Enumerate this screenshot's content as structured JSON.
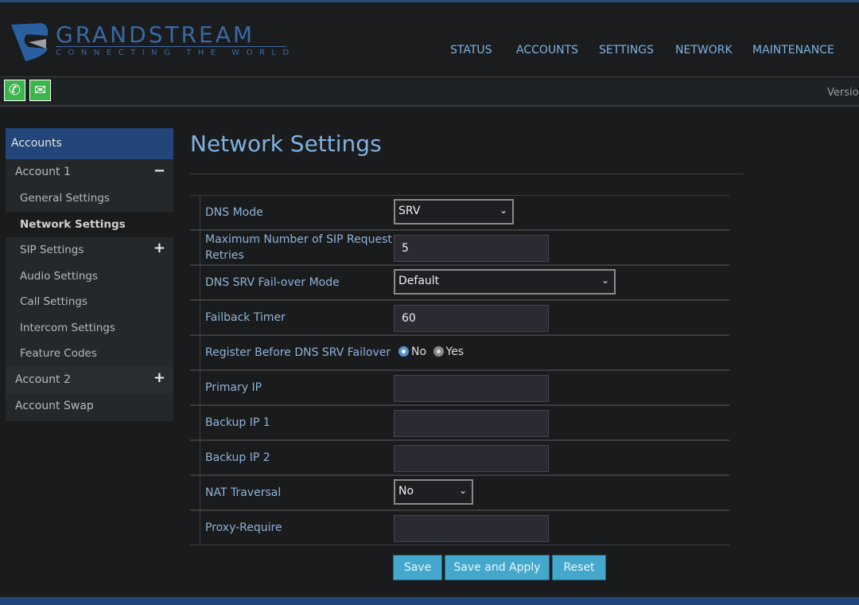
{
  "header": {
    "brand": "GRANDSTREAM",
    "tagline": "CONNECTING THE WORLD",
    "nav": [
      "STATUS",
      "ACCOUNTS",
      "SETTINGS",
      "NETWORK",
      "MAINTENANCE"
    ],
    "version_label": "Version"
  },
  "toolbar": {
    "icons": [
      "phone-icon",
      "contact-card-icon"
    ]
  },
  "sidebar": {
    "heading": "Accounts",
    "account1": "Account 1",
    "items": [
      "General Settings",
      "Network Settings",
      "SIP Settings",
      "Audio Settings",
      "Call Settings",
      "Intercom Settings",
      "Feature Codes"
    ],
    "account2": "Account 2",
    "swap": "Account Swap"
  },
  "page": {
    "title": "Network Settings"
  },
  "form": {
    "dns_mode": {
      "label": "DNS Mode",
      "value": "SRV"
    },
    "max_retries": {
      "label": "Maximum Number of SIP Request Retries",
      "value": "5"
    },
    "failover_mode": {
      "label": "DNS SRV Fail-over Mode",
      "value": "Default"
    },
    "failback_timer": {
      "label": "Failback Timer",
      "value": "60"
    },
    "register_before": {
      "label": "Register Before DNS SRV Failover",
      "options": [
        "No",
        "Yes"
      ],
      "selected": "No"
    },
    "primary_ip": {
      "label": "Primary IP",
      "value": ""
    },
    "backup_ip1": {
      "label": "Backup IP 1",
      "value": ""
    },
    "backup_ip2": {
      "label": "Backup IP 2",
      "value": ""
    },
    "nat": {
      "label": "NAT Traversal",
      "value": "No"
    },
    "proxy_require": {
      "label": "Proxy-Require",
      "value": ""
    }
  },
  "buttons": {
    "save": "Save",
    "save_apply": "Save and Apply",
    "reset": "Reset"
  },
  "colors": {
    "accent": "#7fb2e0",
    "brand": "#22467a",
    "button": "#44a8cc",
    "icon_green": "#3bb54a"
  }
}
